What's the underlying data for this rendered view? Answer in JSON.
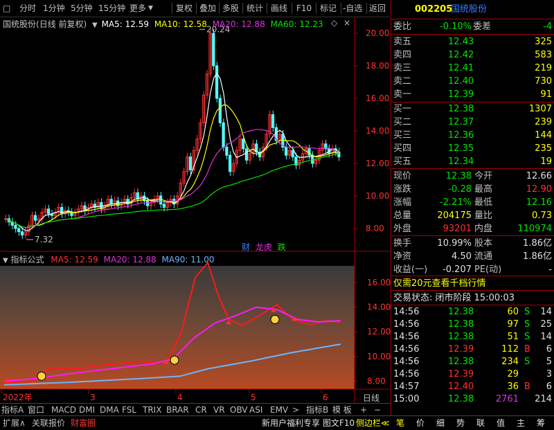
{
  "toolbar": {
    "items": [
      "分时",
      "1分钟",
      "5分钟",
      "15分钟",
      "更多"
    ],
    "more_icon": "chevron-down-icon",
    "actions": [
      "复权",
      "叠加",
      "多股",
      "统计",
      "画线",
      "F10",
      "标记",
      "-自选",
      "返回"
    ]
  },
  "main_chart": {
    "stock_name": "国统股份",
    "mode": "(日线 前复权)",
    "ma_legend": [
      {
        "label": "MA5: 12.59",
        "color": "#ffffff"
      },
      {
        "label": "MA10: 12.58",
        "color": "#ffff00"
      },
      {
        "label": "MA20: 12.88",
        "color": "#e030e0"
      },
      {
        "label": "MA60: 12.23",
        "color": "#00e600"
      }
    ],
    "price_axis": [
      "20.00",
      "18.00",
      "16.00",
      "14.00",
      "12.00",
      "10.00",
      "8.00"
    ],
    "high_label": "20.24",
    "low_label": "7.32",
    "badges": [
      {
        "text": "财",
        "color": "#3c7cff"
      },
      {
        "text": "龙虎",
        "color": "#e030e0"
      },
      {
        "text": "跌",
        "color": "#00e600"
      }
    ]
  },
  "indicator": {
    "title": "指标公式",
    "legend": [
      {
        "label": "MA5: 12.59",
        "color": "#ff3232"
      },
      {
        "label": "MA20: 12.88",
        "color": "#e030e0"
      },
      {
        "label": "MA90: 11.00",
        "color": "#6ab6ff"
      }
    ],
    "axis": [
      "16.00",
      "14.00",
      "12.00",
      "10.00",
      "8.00"
    ]
  },
  "time_axis": {
    "labels": [
      "2022年",
      "3",
      "4",
      "5",
      "6"
    ],
    "period": "日线"
  },
  "bottom_tabs": [
    "指标A",
    "窗口",
    "MACD",
    "DMI",
    "DMA",
    "FSL",
    "TRIX",
    "BRAR",
    "CR",
    "VR",
    "OBV",
    "ASI",
    "EMV",
    ">",
    "指标B",
    "模 板",
    "+",
    "−"
  ],
  "status_bar": {
    "left": [
      "扩展∧",
      "关联报价",
      "财富圈"
    ],
    "right": [
      "新用户福利专享",
      "图文F10",
      "侧边栏≪"
    ],
    "tabs": [
      "笔",
      "价",
      "细",
      "势",
      "联",
      "值",
      "主",
      "筹"
    ]
  },
  "quote": {
    "code": "002205",
    "name": "国统股份",
    "weibi_label": "委比",
    "weibi_value": "-0.10%",
    "weicha_label": "委差",
    "weicha_value": "-4",
    "sell": [
      {
        "label": "卖五",
        "price": "12.43",
        "vol": "325"
      },
      {
        "label": "卖四",
        "price": "12.42",
        "vol": "583"
      },
      {
        "label": "卖三",
        "price": "12.41",
        "vol": "219"
      },
      {
        "label": "卖二",
        "price": "12.40",
        "vol": "730"
      },
      {
        "label": "卖一",
        "price": "12.39",
        "vol": "91"
      }
    ],
    "buy": [
      {
        "label": "买一",
        "price": "12.38",
        "vol": "1307"
      },
      {
        "label": "买二",
        "price": "12.37",
        "vol": "239"
      },
      {
        "label": "买三",
        "price": "12.36",
        "vol": "144"
      },
      {
        "label": "买四",
        "price": "12.35",
        "vol": "235"
      },
      {
        "label": "买五",
        "price": "12.34",
        "vol": "19"
      }
    ],
    "stats": [
      {
        "l1": "现价",
        "v1": "12.38",
        "c1": "green",
        "l2": "今开",
        "v2": "12.66",
        "c2": "white"
      },
      {
        "l1": "涨跌",
        "v1": "-0.28",
        "c1": "green",
        "l2": "最高",
        "v2": "12.90",
        "c2": "red"
      },
      {
        "l1": "涨幅",
        "v1": "-2.21%",
        "c1": "green",
        "l2": "最低",
        "v2": "12.16",
        "c2": "green"
      },
      {
        "l1": "总量",
        "v1": "204175",
        "c1": "yellow",
        "l2": "量比",
        "v2": "0.73",
        "c2": "yellow"
      },
      {
        "l1": "外盘",
        "v1": "93201",
        "c1": "red",
        "l2": "内盘",
        "v2": "110974",
        "c2": "green"
      }
    ],
    "stats2": [
      {
        "l1": "换手",
        "v1": "10.99%",
        "l2": "股本",
        "v2": "1.86亿"
      },
      {
        "l1": "净资",
        "v1": "4.50",
        "l2": "流通",
        "v2": "1.86亿"
      },
      {
        "l1": "收益(一)",
        "v1": "-0.207",
        "l2": "PE(动)",
        "v2": "-"
      }
    ],
    "promo": "仅需20元查看千档行情",
    "trade_status": "交易状态: 闭市阶段 15:00:03",
    "ticks": [
      {
        "t": "14:56",
        "p": "12.38",
        "v": "60",
        "s": "S"
      },
      {
        "t": "14:56",
        "p": "12.38",
        "v": "97",
        "s": "S"
      },
      {
        "t": "14:56",
        "p": "12.38",
        "v": "51",
        "s": "S"
      },
      {
        "t": "14:56",
        "p": "12.39",
        "v": "112",
        "s": "B"
      },
      {
        "t": "14:56",
        "p": "12.38",
        "v": "234",
        "s": "S"
      },
      {
        "t": "14:56",
        "p": "12.39",
        "v": "29",
        "s": ""
      },
      {
        "t": "14:57",
        "p": "12.40",
        "v": "36",
        "s": "B"
      },
      {
        "t": "15:00",
        "p": "12.38",
        "v": "2761",
        "s": ""
      }
    ],
    "tick_counts": [
      "14",
      "25",
      "14",
      "6",
      "5",
      "3",
      "6",
      "214"
    ]
  }
}
